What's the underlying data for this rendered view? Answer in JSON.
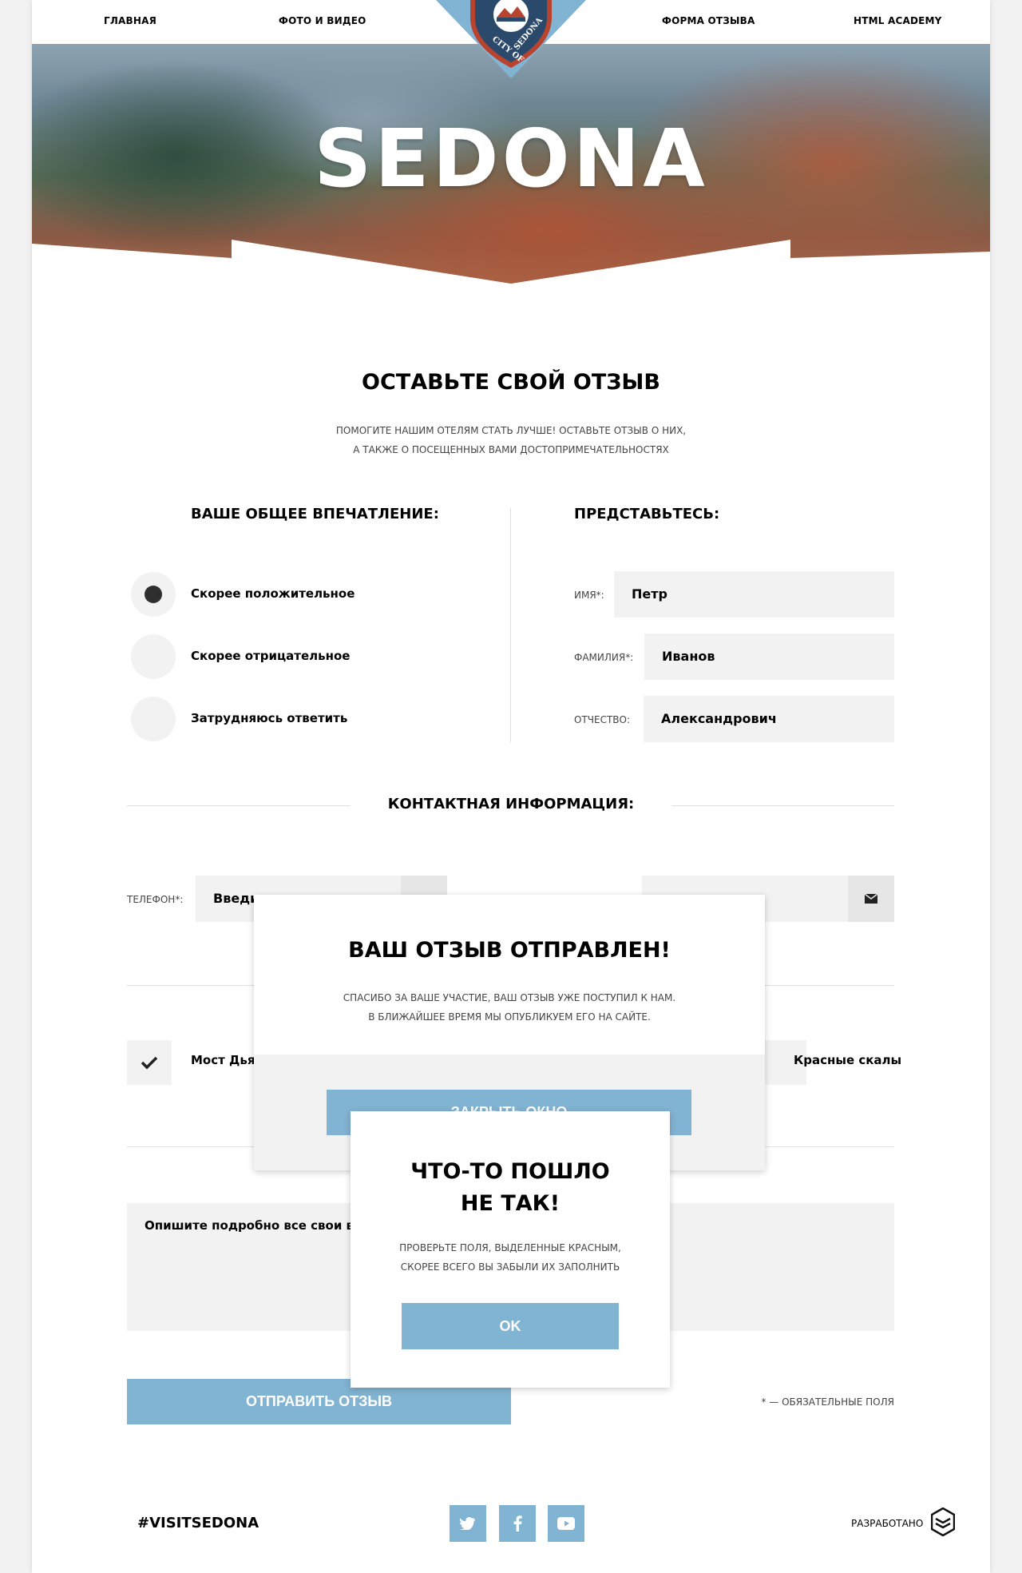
{
  "nav": {
    "items": [
      "ГЛАВНАЯ",
      "ФОТО И ВИДЕО",
      "ФОРМА ОТЗЫВА",
      "HTML ACADEMY"
    ],
    "logo_text": "CITY OF SEDONA"
  },
  "hero": {
    "title": "SEDONA"
  },
  "form": {
    "title": "ОСТАВЬТЕ СВОЙ ОТЗЫВ",
    "intro_line1": "ПОМОГИТЕ НАШИМ ОТЕЛЯМ СТАТЬ ЛУЧШЕ! ОСТАВЬТЕ ОТЗЫВ О НИХ,",
    "intro_line2": "А ТАКЖЕ О ПОСЕЩЕННЫХ ВАМИ ДОСТОПРИМЕЧАТЕЛЬНОСТЯХ",
    "impression": {
      "title": "ВАШЕ ОБЩЕЕ ВПЕЧАТЛЕНИЕ:",
      "options": [
        "Скорее положительное",
        "Скорее отрицательное",
        "Затрудняюсь ответить"
      ],
      "selected": "Скорее положительное"
    },
    "identity": {
      "title": "ПРЕДСТАВЬТЕСЬ:",
      "name_label": "ИМЯ*:",
      "name_value": "Петр",
      "surname_label": "ФАМИЛИЯ*:",
      "surname_value": "Иванов",
      "patronymic_label": "ОТЧЕСТВО:",
      "patronymic_value": "Александрович"
    },
    "contacts": {
      "title": "КОНТАКТНАЯ ИНФОРМАЦИЯ:",
      "phone_label": "ТЕЛЕФОН*:",
      "phone_visible_text": "Введит"
    },
    "places": {
      "left_label": "Мост Дья",
      "right_label": "Красные скалы"
    },
    "textarea_placeholder": "Опишите подробно все свои вос",
    "submit_label": "ОТПРАВИТЬ ОТЗЫВ",
    "required_note": "* — ОБЯЗАТЕЛЬНЫЕ ПОЛЯ"
  },
  "footer": {
    "hashtag": "#VISITSEDONA",
    "developed": "РАЗРАБОТАНО"
  },
  "modal_success": {
    "title": "ВАШ ОТЗЫВ ОТПРАВЛЕН!",
    "text_line1": "СПАСИБО ЗА ВАШЕ УЧАСТИЕ, ВАШ ОТЗЫВ УЖЕ ПОСТУПИЛ К НАМ.",
    "text_line2": "В БЛИЖАЙШЕЕ ВРЕМЯ МЫ ОПУБЛИКУЕМ ЕГО НА САЙТЕ.",
    "button_label": "ЗАКРЫТЬ ОКНО"
  },
  "modal_error": {
    "title_line1": "ЧТО-ТО ПОШЛО",
    "title_line2": "НЕ ТАК!",
    "text_line1": "ПРОВЕРЬТЕ ПОЛЯ, ВЫДЕЛЕННЫЕ КРАСНЫМ,",
    "text_line2": "СКОРЕЕ ВСЕГО ВЫ ЗАБЫЛИ ИХ ЗАПОЛНИТЬ",
    "button_label": "OK"
  },
  "colors": {
    "accent": "#81b3d2",
    "field_bg": "#f2f2f2",
    "text": "#000000"
  },
  "icons": [
    "email-icon",
    "checkmark-icon",
    "twitter-icon",
    "facebook-icon",
    "youtube-icon",
    "developer-logo-icon"
  ]
}
